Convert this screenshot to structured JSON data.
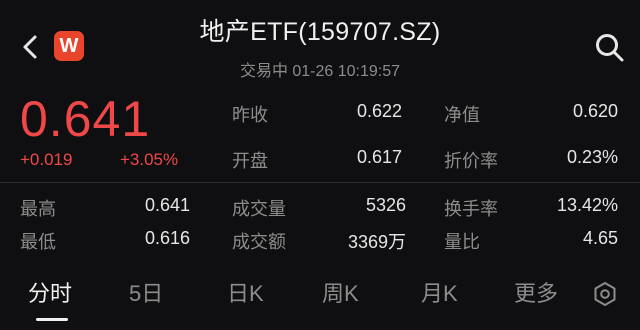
{
  "header": {
    "title": "地产ETF(159707.SZ)",
    "subtitle": "交易中 01-26 10:19:57",
    "logo_letter": "W"
  },
  "quote": {
    "price": "0.641",
    "change": "+0.019",
    "change_pct": "+3.05%"
  },
  "stats": {
    "prev_close_label": "昨收",
    "prev_close": "0.622",
    "nav_label": "净值",
    "nav": "0.620",
    "open_label": "开盘",
    "open": "0.617",
    "discount_label": "折价率",
    "discount": "0.23%",
    "high_label": "最高",
    "high": "0.641",
    "volume_label": "成交量",
    "volume": "5326",
    "turnover_label": "换手率",
    "turnover": "13.42%",
    "low_label": "最低",
    "low": "0.616",
    "amount_label": "成交额",
    "amount": "3369万",
    "vol_ratio_label": "量比",
    "vol_ratio": "4.65"
  },
  "tabs": [
    "分时",
    "5日",
    "日K",
    "周K",
    "月K",
    "更多"
  ],
  "colors": {
    "up": "#f04848",
    "background": "#0f0f11",
    "logo": "#e8452c"
  },
  "icons": [
    "back-arrow-icon",
    "app-logo-icon",
    "search-icon",
    "settings-icon"
  ]
}
